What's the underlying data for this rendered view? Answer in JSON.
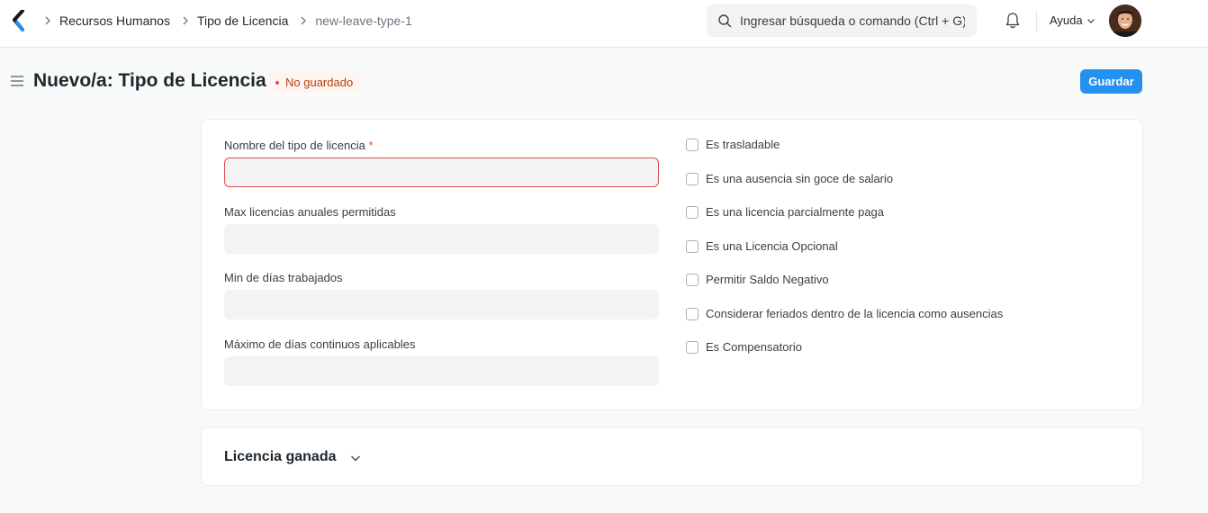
{
  "navbar": {
    "breadcrumbs": [
      "Recursos Humanos",
      "Tipo de Licencia",
      "new-leave-type-1"
    ],
    "search_placeholder": "Ingresar búsqueda o comando (Ctrl + G)",
    "help_label": "Ayuda"
  },
  "page": {
    "title": "Nuevo/a: Tipo de Licencia",
    "status": "No guardado",
    "save_label": "Guardar"
  },
  "form": {
    "fields": [
      {
        "label": "Nombre del tipo de licencia",
        "required": "*",
        "value": ""
      },
      {
        "label": "Max licencias anuales permitidas",
        "value": ""
      },
      {
        "label": "Min de días trabajados",
        "value": ""
      },
      {
        "label": "Máximo de días continuos aplicables",
        "value": ""
      }
    ],
    "checkboxes": [
      {
        "label": "Es trasladable",
        "checked": false
      },
      {
        "label": "Es una ausencia sin goce de salario",
        "checked": false
      },
      {
        "label": "Es una licencia parcialmente paga",
        "checked": false
      },
      {
        "label": "Es una Licencia Opcional",
        "checked": false
      },
      {
        "label": "Permitir Saldo Negativo",
        "checked": false
      },
      {
        "label": "Considerar feriados dentro de la licencia como ausencias",
        "checked": false
      },
      {
        "label": "Es Compensatorio",
        "checked": false
      }
    ]
  },
  "sections": [
    {
      "title": "Licencia ganada",
      "collapsed": true
    }
  ],
  "colors": {
    "primary": "#2490ef",
    "error": "#e24c4c",
    "status_text": "#b5400f",
    "status_bg": "#fff5f0"
  },
  "icons": [
    "frappe-logo-icon",
    "chevron-right-icon",
    "search-icon",
    "bell-icon",
    "chevron-down-icon",
    "hamburger-icon"
  ]
}
